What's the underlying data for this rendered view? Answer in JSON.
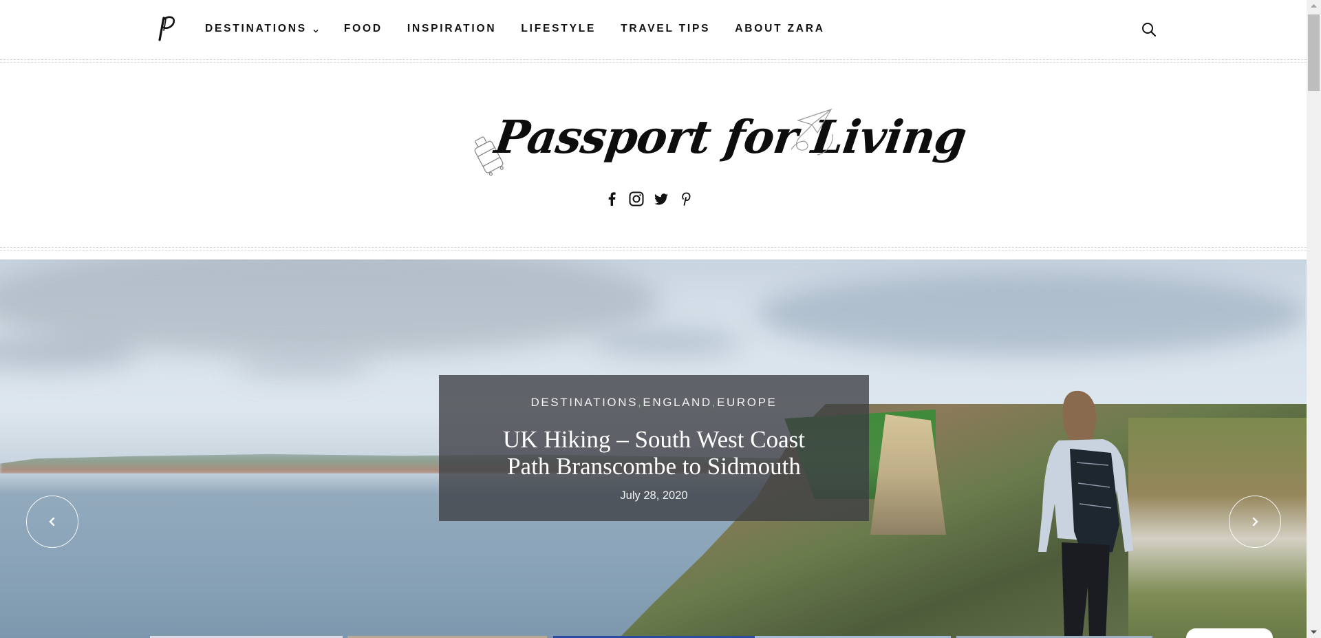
{
  "nav": {
    "logo_alt": "P",
    "items": [
      {
        "label": "DESTINATIONS",
        "has_dropdown": true
      },
      {
        "label": "FOOD",
        "has_dropdown": false
      },
      {
        "label": "INSPIRATION",
        "has_dropdown": false
      },
      {
        "label": "LIFESTYLE",
        "has_dropdown": false
      },
      {
        "label": "TRAVEL TIPS",
        "has_dropdown": false
      },
      {
        "label": "ABOUT ZARA",
        "has_dropdown": false
      }
    ],
    "search_icon": "search-icon"
  },
  "header": {
    "site_title": "Passport for Living",
    "social_icons": [
      "facebook-icon",
      "instagram-icon",
      "twitter-icon",
      "pinterest-icon"
    ]
  },
  "slider": {
    "categories": [
      "DESTINATIONS",
      "ENGLAND",
      "EUROPE"
    ],
    "category_separator": ",",
    "title": "UK Hiking – South West Coast Path Branscombe to Sidmouth",
    "date": "July 28, 2020",
    "prev_icon": "chevron-left-icon",
    "next_icon": "chevron-right-icon",
    "accent_color": "#8fbf7f",
    "overlay_color": "#3c3e42"
  },
  "colors": {
    "text": "#111111",
    "divider": "#d6d6d6"
  }
}
